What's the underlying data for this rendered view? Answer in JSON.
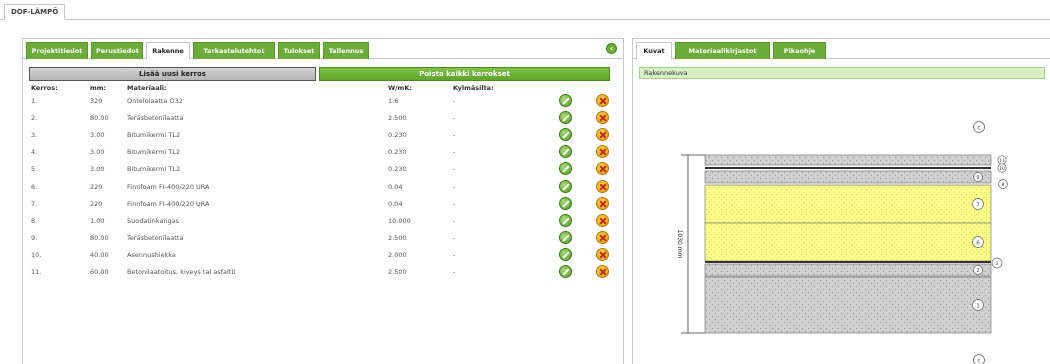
{
  "app_tab": {
    "label": "DOF-LÄMPÖ"
  },
  "left_tabs": [
    {
      "label": "Projektitiedot",
      "active": false
    },
    {
      "label": "Perustiedot",
      "active": false
    },
    {
      "label": "Rakenne",
      "active": true
    },
    {
      "label": "Tarkastelutehtot",
      "active": false
    },
    {
      "label": "Tulokset",
      "active": false
    },
    {
      "label": "Tallennus",
      "active": false
    }
  ],
  "actions": {
    "add_layer": "Lisää uusi kerros",
    "remove_all": "Poista kaikki kerrokset"
  },
  "table": {
    "headers": {
      "layer": "Kerros:",
      "mm": "mm:",
      "material": "Materiaali:",
      "conductivity": "W/mK:",
      "thermal_bridge": "Kylmäsilta:"
    },
    "rows": [
      {
        "layer": "1.",
        "mm": "320",
        "material": "Ontelolaatta O32",
        "conductivity": "1.6",
        "thermal_bridge": "-"
      },
      {
        "layer": "2.",
        "mm": "80.00",
        "material": "Teräsbetonilaatta",
        "conductivity": "2.500",
        "thermal_bridge": "-"
      },
      {
        "layer": "3.",
        "mm": "3.00",
        "material": "Bitumikermi TL2",
        "conductivity": "0.230",
        "thermal_bridge": "-"
      },
      {
        "layer": "4.",
        "mm": "3.00",
        "material": "Bitumikermi TL2",
        "conductivity": "0.230",
        "thermal_bridge": "-"
      },
      {
        "layer": "5.",
        "mm": "3.00",
        "material": "Bitumikermi TL2",
        "conductivity": "0.230",
        "thermal_bridge": "-"
      },
      {
        "layer": "6.",
        "mm": "220",
        "material": "Finnfoam FI-400/220 URA",
        "conductivity": "0.04",
        "thermal_bridge": "-"
      },
      {
        "layer": "7.",
        "mm": "220",
        "material": "Finnfoam FI-400/220 URA",
        "conductivity": "0.04",
        "thermal_bridge": "-"
      },
      {
        "layer": "8.",
        "mm": "1.00",
        "material": "Suodatinkangas",
        "conductivity": "10.000",
        "thermal_bridge": "-"
      },
      {
        "layer": "9.",
        "mm": "80.00",
        "material": "Teräsbetonilaatta",
        "conductivity": "2.500",
        "thermal_bridge": "-"
      },
      {
        "layer": "10.",
        "mm": "40.00",
        "material": "Asennushiekka",
        "conductivity": "2.000",
        "thermal_bridge": "-"
      },
      {
        "layer": "11.",
        "mm": "60.00",
        "material": "Betonilaatoitus, kiveys tai asfaltti",
        "conductivity": "2.500",
        "thermal_bridge": "-"
      }
    ]
  },
  "right_tabs": [
    {
      "label": "Kuvat",
      "active": true
    },
    {
      "label": "Materiaalikirjastot",
      "active": false
    },
    {
      "label": "Pikaohje",
      "active": false
    }
  ],
  "structure_image": {
    "label": "Rakennekuva",
    "dimension_label": "1030 mm",
    "layers": [
      {
        "fill": "#d0d0d0",
        "marker": ""
      },
      {
        "fill": "#d0d0d0",
        "marker": "9"
      },
      {
        "fill": "#ffff8a",
        "marker": "7"
      },
      {
        "fill": "#ffff8a",
        "marker": "6"
      },
      {
        "fill": "#d0d0d0",
        "marker": "2"
      },
      {
        "fill": "#d0d0d0",
        "marker": "1"
      }
    ],
    "side_markers": [
      "11",
      "10",
      "8",
      "3"
    ],
    "top_circle": "c",
    "bottom_circle": "c"
  },
  "icons": {
    "edit": "edit-icon",
    "delete": "delete-icon",
    "collapse": "collapse-left-icon"
  },
  "colors": {
    "accent_green": "#6cac3a",
    "insulation_yellow": "#ffff8a",
    "concrete_grey": "#d0d0d0"
  }
}
